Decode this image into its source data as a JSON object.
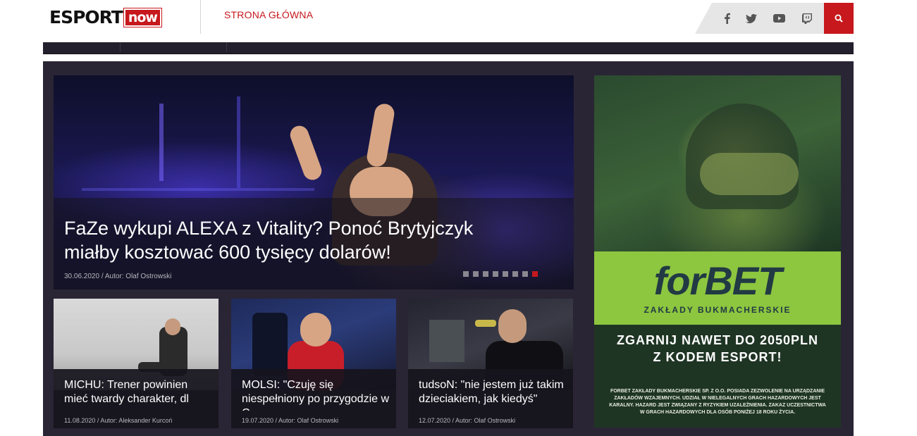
{
  "header": {
    "logo_esport": "ESPORT",
    "logo_now": "now",
    "nav_home": "STRONA GŁÓWNA",
    "social_icons": [
      "facebook-icon",
      "twitter-icon",
      "youtube-icon",
      "twitch-icon"
    ],
    "search_icon": "search-icon"
  },
  "colors": {
    "brand_red": "#c6181d",
    "dark_panel": "#2a2535",
    "ad_green": "#8dc63f"
  },
  "hero": {
    "title": "FaZe wykupi ALEXA z Vitality? Ponoć Brytyjczyk miałby kosztować 600 tysięcy dolarów!",
    "meta": "30.06.2020 / Autor: Olaf Ostrowski",
    "slide_count": 8,
    "active_slide": 8
  },
  "cards": [
    {
      "title": "MICHU: Trener powinien mieć twardy charakter, dl",
      "meta": "11.08.2020 / Autor: Aleksander Kurcoń"
    },
    {
      "title": "MOLSI: \"Czuję się niespełniony po przygodzie w C",
      "meta": "19.07.2020 / Autor: Olaf Ostrowski"
    },
    {
      "title": "tudsoN: \"nie jestem już takim dzieciakiem, jak kiedyś\"",
      "meta": "12.07.2020 / Autor: Olaf Ostrowski"
    }
  ],
  "ad": {
    "logo": "forBET",
    "subtitle": "ZAKŁADY BUKMACHERSKIE",
    "promo_line1": "ZGARNIJ NAWET DO 2050PLN",
    "promo_line2": "Z KODEM ESPORT!",
    "legal": "FORBET ZAKŁADY BUKMACHERSKIE SP. Z O.O. POSIADA ZEZWOLENIE NA URZĄDZANIE ZAKŁADÓW WZAJEMNYCH. UDZIAŁ W NIELEGALNYCH GRACH HAZARDOWYCH JEST KARALNY. HAZARD JEST ZWIĄZANY Z RYZYKIEM UZALEŻNIENIA. ZAKAZ UCZESTNICTWA W GRACH HAZARDOWYCH DLA OSÓB PONIŻEJ 18 ROKU ŻYCIA."
  }
}
